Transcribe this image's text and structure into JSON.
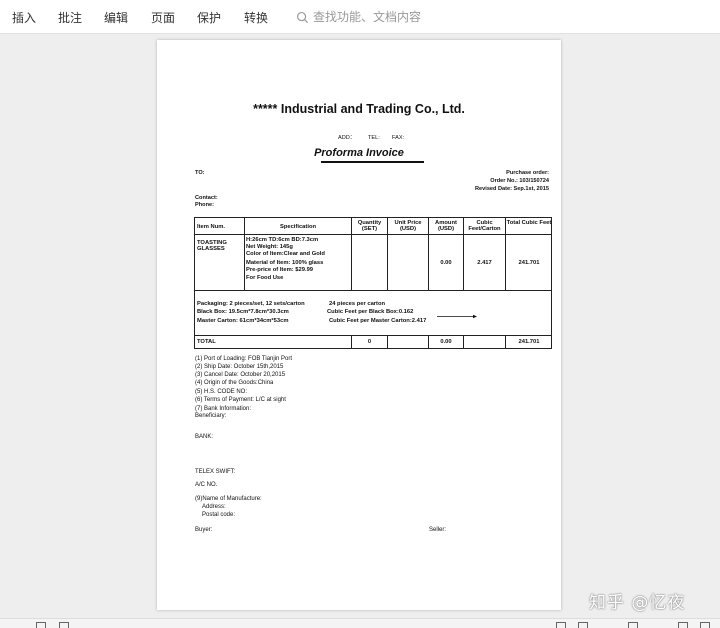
{
  "toolbar": {
    "menu": [
      "插入",
      "批注",
      "编辑",
      "页面",
      "保护",
      "转换"
    ],
    "search_placeholder": "查找功能、文档内容"
  },
  "document": {
    "company": "***** Industrial and Trading Co., Ltd.",
    "contact_line": {
      "add": "ADD：",
      "tel": "TEL:",
      "fax": "FAX:"
    },
    "title": "Proforma Invoice",
    "to": "TO:",
    "purchase_order": "Purchase order:",
    "order_no": "Order No.: 103/150724",
    "revised_date": "Revised Date: Sep.1st, 2015",
    "contact": "Contact:",
    "phone": "Phone:",
    "table": {
      "headers": [
        "Item Num.",
        "Specification",
        "Quantity (SET)",
        "Unit Price (USD)",
        "Amount (USD)",
        "Cubic Feet/Carton",
        "Total Cubic Feet"
      ],
      "row": {
        "item": "TOASTING GLASSES",
        "spec": [
          "H:26cm  TD:6cm  BD:7.3cm",
          "Net Weight: 145g",
          "Color of Item:Clear and Gold",
          "Material of Item: 100% glass",
          "Pre-price of Item: $29.99",
          "For Food Use"
        ],
        "quantity": "",
        "unit_price": "",
        "amount": "0.00",
        "cubic_carton": "2.417",
        "total_cubic": "241.701"
      },
      "packaging": {
        "line1": "Packaging: 2 pieces/set, 12 sets/carton",
        "line1b": "24 pieces  per carton",
        "line2": "Black Box: 19.5cm*7.8cm*30.3cm",
        "line2b": "Cubic Feet per Black Box:0.162",
        "line3": "Master Carton: 61cm*34cm*53cm",
        "line3b": "Cubic Feet per Master Carton:2.417"
      },
      "total": {
        "label": "TOTAL",
        "quantity": "0",
        "amount": "0.00",
        "total_cubic": "241.701"
      }
    },
    "terms": [
      "(1) Port of Loading: FOB Tianjin Port",
      "(2) Ship Date:  October 15th,2015",
      "(3) Cancel Date:  October 20,2015",
      "(4) Origin of the Goods:China",
      "(5) H.S.  CODE NO:",
      "(6) Terms of Payment: L/C at sight",
      "(7) Bank Information:",
      "Beneficiary:"
    ],
    "bank": "BANK:",
    "telex": "TELEX SWIFT:",
    "ac_no": "A/C NO.",
    "manufacture": "(9)Name of Manufacture:",
    "address": "Address:",
    "postal": "Postal code:",
    "buyer": "Buyer:",
    "seller": "Seller:"
  },
  "watermark": "知乎 @忆夜"
}
